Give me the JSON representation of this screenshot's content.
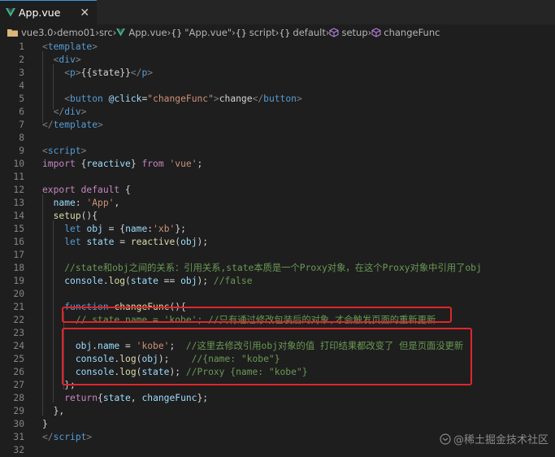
{
  "tab": {
    "label": "App.vue",
    "close": "✕"
  },
  "breadcrumb": [
    {
      "icon": "folder-icon",
      "label": "vue3.0"
    },
    {
      "icon": "",
      "label": "demo01"
    },
    {
      "icon": "",
      "label": "src"
    },
    {
      "icon": "vue-icon",
      "label": "App.vue"
    },
    {
      "icon": "braces-icon",
      "label": "\"App.vue\""
    },
    {
      "icon": "braces-icon",
      "label": "script"
    },
    {
      "icon": "braces-icon",
      "label": "default"
    },
    {
      "icon": "cube-icon",
      "label": "setup"
    },
    {
      "icon": "cube-icon",
      "label": "changeFunc"
    }
  ],
  "lines": [
    [
      [
        "t-punct",
        "<"
      ],
      [
        "t-tag",
        "template"
      ],
      [
        "t-punct",
        ">"
      ]
    ],
    [
      [
        "t-text",
        "  "
      ],
      [
        "t-punct",
        "<"
      ],
      [
        "t-tag",
        "div"
      ],
      [
        "t-punct",
        ">"
      ]
    ],
    [
      [
        "t-text",
        "    "
      ],
      [
        "t-punct",
        "<"
      ],
      [
        "t-tag",
        "p"
      ],
      [
        "t-punct",
        ">"
      ],
      [
        "t-text",
        "{{state}}"
      ],
      [
        "t-punct",
        "</"
      ],
      [
        "t-tag",
        "p"
      ],
      [
        "t-punct",
        ">"
      ]
    ],
    [],
    [
      [
        "t-text",
        "    "
      ],
      [
        "t-punct",
        "<"
      ],
      [
        "t-tag",
        "button"
      ],
      [
        "t-text",
        " "
      ],
      [
        "t-attr",
        "@click"
      ],
      [
        "t-text",
        "="
      ],
      [
        "t-str",
        "\"changeFunc\""
      ],
      [
        "t-punct",
        ">"
      ],
      [
        "t-text",
        "change"
      ],
      [
        "t-punct",
        "</"
      ],
      [
        "t-tag",
        "button"
      ],
      [
        "t-punct",
        ">"
      ]
    ],
    [
      [
        "t-text",
        "  "
      ],
      [
        "t-punct",
        "</"
      ],
      [
        "t-tag",
        "div"
      ],
      [
        "t-punct",
        ">"
      ]
    ],
    [
      [
        "t-punct",
        "</"
      ],
      [
        "t-tag",
        "template"
      ],
      [
        "t-punct",
        ">"
      ]
    ],
    [],
    [
      [
        "t-punct",
        "<"
      ],
      [
        "t-tag",
        "script"
      ],
      [
        "t-punct",
        ">"
      ]
    ],
    [
      [
        "t-kw",
        "import"
      ],
      [
        "t-text",
        " {"
      ],
      [
        "t-var",
        "reactive"
      ],
      [
        "t-text",
        "} "
      ],
      [
        "t-kw",
        "from"
      ],
      [
        "t-text",
        " "
      ],
      [
        "t-str",
        "'vue'"
      ],
      [
        "t-text",
        ";"
      ]
    ],
    [],
    [
      [
        "t-kw",
        "export"
      ],
      [
        "t-text",
        " "
      ],
      [
        "t-kw",
        "default"
      ],
      [
        "t-text",
        " {"
      ]
    ],
    [
      [
        "t-text",
        "  "
      ],
      [
        "t-var",
        "name"
      ],
      [
        "t-text",
        ": "
      ],
      [
        "t-str",
        "'App'"
      ],
      [
        "t-text",
        ","
      ]
    ],
    [
      [
        "t-text",
        "  "
      ],
      [
        "t-fn",
        "setup"
      ],
      [
        "t-text",
        "(){"
      ]
    ],
    [
      [
        "t-text",
        "    "
      ],
      [
        "t-kw2",
        "let"
      ],
      [
        "t-text",
        " "
      ],
      [
        "t-var",
        "obj"
      ],
      [
        "t-text",
        " = {"
      ],
      [
        "t-var",
        "name"
      ],
      [
        "t-text",
        ":"
      ],
      [
        "t-str",
        "'xb'"
      ],
      [
        "t-text",
        "};"
      ]
    ],
    [
      [
        "t-text",
        "    "
      ],
      [
        "t-kw2",
        "let"
      ],
      [
        "t-text",
        " "
      ],
      [
        "t-var",
        "state"
      ],
      [
        "t-text",
        " = "
      ],
      [
        "t-fn",
        "reactive"
      ],
      [
        "t-text",
        "("
      ],
      [
        "t-var",
        "obj"
      ],
      [
        "t-text",
        ");"
      ]
    ],
    [],
    [
      [
        "t-text",
        "    "
      ],
      [
        "t-cm",
        "//state和obj之间的关系：引用关系,state本质是一个Proxy对象，在这个Proxy对象中引用了obj"
      ]
    ],
    [
      [
        "t-text",
        "    "
      ],
      [
        "t-var",
        "console"
      ],
      [
        "t-text",
        "."
      ],
      [
        "t-fn",
        "log"
      ],
      [
        "t-text",
        "("
      ],
      [
        "t-var",
        "state"
      ],
      [
        "t-text",
        " == "
      ],
      [
        "t-var",
        "obj"
      ],
      [
        "t-text",
        "); "
      ],
      [
        "t-cm",
        "//false"
      ]
    ],
    [],
    [
      [
        "t-text",
        "    "
      ],
      [
        "t-kw2",
        "function"
      ],
      [
        "t-text",
        " "
      ],
      [
        "t-fn",
        "changeFunc"
      ],
      [
        "t-text",
        "(){"
      ]
    ],
    [
      [
        "t-text",
        "      "
      ],
      [
        "t-cm",
        "// state.name = 'kobe'; //只有通过修改包装后的对象,才会触发页面的重新更新"
      ]
    ],
    [],
    [
      [
        "t-text",
        "      "
      ],
      [
        "t-var",
        "obj"
      ],
      [
        "t-text",
        "."
      ],
      [
        "t-var",
        "name"
      ],
      [
        "t-text",
        " = "
      ],
      [
        "t-str",
        "'kobe'"
      ],
      [
        "t-text",
        ";  "
      ],
      [
        "t-cm",
        "//这里去修改引用obj对象的值 打印结果都改变了 但是页面没更新"
      ]
    ],
    [
      [
        "t-text",
        "      "
      ],
      [
        "t-var",
        "console"
      ],
      [
        "t-text",
        "."
      ],
      [
        "t-fn",
        "log"
      ],
      [
        "t-text",
        "("
      ],
      [
        "t-var",
        "obj"
      ],
      [
        "t-text",
        ");    "
      ],
      [
        "t-cm",
        "//{name: \"kobe\"}"
      ]
    ],
    [
      [
        "t-text",
        "      "
      ],
      [
        "t-var",
        "console"
      ],
      [
        "t-text",
        "."
      ],
      [
        "t-fn",
        "log"
      ],
      [
        "t-text",
        "("
      ],
      [
        "t-var",
        "state"
      ],
      [
        "t-text",
        "); "
      ],
      [
        "t-cm",
        "//Proxy {name: \"kobe\"}"
      ]
    ],
    [
      [
        "t-text",
        "    };"
      ]
    ],
    [
      [
        "t-text",
        "    "
      ],
      [
        "t-kw",
        "return"
      ],
      [
        "t-text",
        "{"
      ],
      [
        "t-var",
        "state"
      ],
      [
        "t-text",
        ", "
      ],
      [
        "t-var",
        "changeFunc"
      ],
      [
        "t-text",
        "};"
      ]
    ],
    [
      [
        "t-text",
        "  },"
      ]
    ],
    [
      [
        "t-text",
        "}"
      ]
    ],
    [
      [
        "t-punct",
        "</"
      ],
      [
        "t-tag",
        "script"
      ],
      [
        "t-punct",
        ">"
      ]
    ],
    []
  ],
  "watermark": "@稀土掘金技术社区",
  "colors": {
    "accent": "#3a96dd",
    "highlight_box": "#e0252b",
    "background": "#1e1e1e"
  }
}
